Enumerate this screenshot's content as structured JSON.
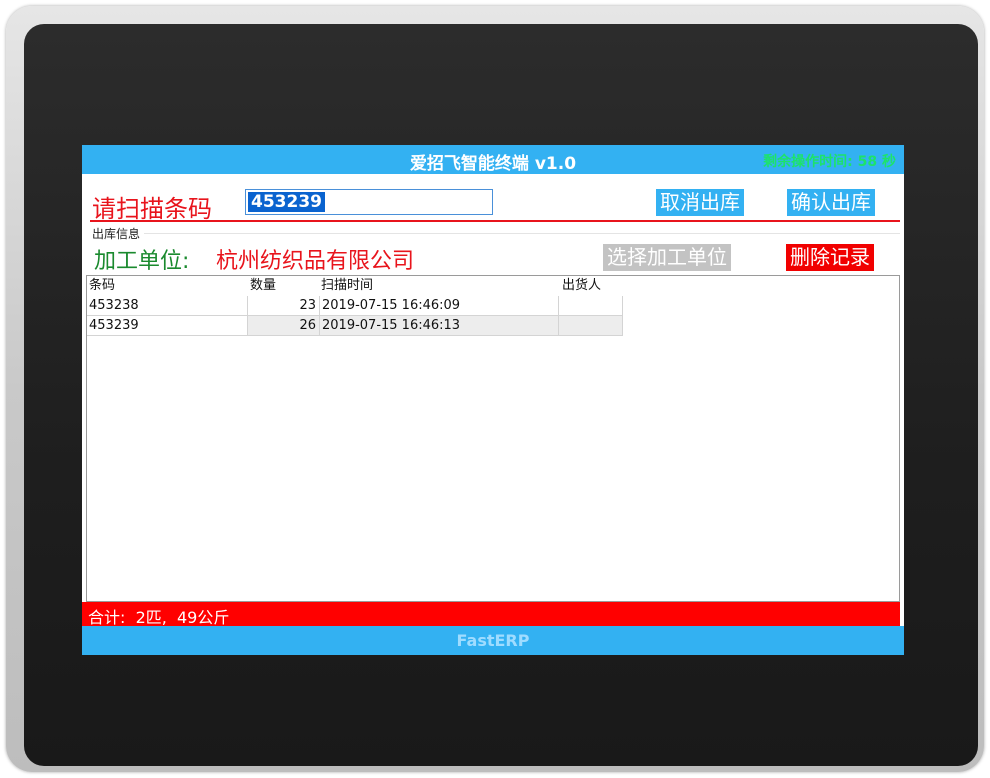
{
  "app": {
    "title": "爱招飞智能终端 v1.0",
    "timer": "剩余操作时间: 58 秒",
    "footer_brand": "FastERP"
  },
  "scan": {
    "label": "请扫描条码",
    "value": "453239"
  },
  "buttons": {
    "cancel_out": "取消出库",
    "confirm_out": "确认出库",
    "select_unit": "选择加工单位",
    "delete_record": "删除记录"
  },
  "info": {
    "group_label": "出库信息",
    "unit_label": "加工单位:",
    "unit_value": "杭州纺织品有限公司"
  },
  "table": {
    "headers": [
      "条码",
      "数量",
      "扫描时间",
      "出货人"
    ],
    "rows": [
      [
        "453238",
        "23",
        "2019-07-15 16:46:09",
        ""
      ],
      [
        "453239",
        "26",
        "2019-07-15 16:46:13",
        ""
      ]
    ]
  },
  "summary": {
    "text": "合计:  2匹,  49公斤"
  },
  "colors": {
    "accent_blue": "#33b1f2",
    "alert_red": "#e8141c",
    "timer_green": "#1de36a",
    "label_green": "#1a8a2e",
    "selection_blue": "#0a63cf"
  }
}
